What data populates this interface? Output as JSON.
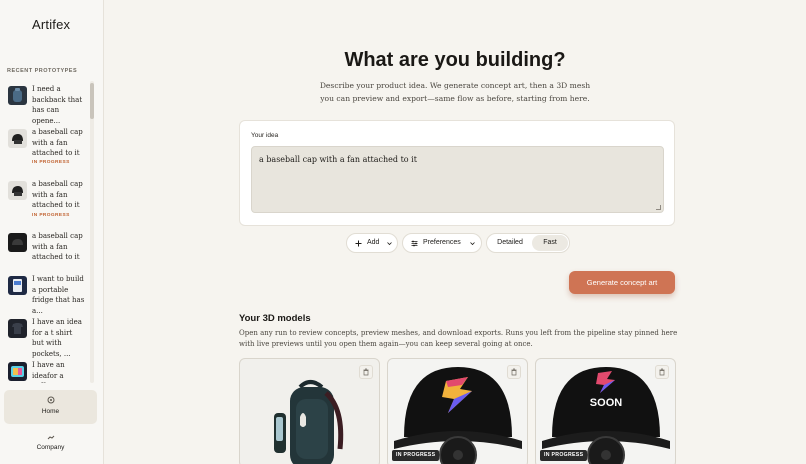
{
  "app": {
    "brand": "Artifex"
  },
  "sidebar": {
    "recent_title": "RECENT PROTOTYPES",
    "items": [
      {
        "text": "I need a backback that has can opene...",
        "status": "",
        "thumb": "backpack"
      },
      {
        "text": "a baseball cap with a fan attached to it",
        "status": "IN PROGRESS",
        "thumb": "cap"
      },
      {
        "text": "a baseball cap with a fan attached to it",
        "status": "IN PROGRESS",
        "thumb": "cap"
      },
      {
        "text": "a baseball cap with a fan attached to it",
        "status": "",
        "thumb": "cap"
      },
      {
        "text": "I want to build a portable fridge that has a...",
        "status": "",
        "thumb": "fridge"
      },
      {
        "text": "I have an idea for a t shirt but with pockets, ...",
        "status": "",
        "thumb": "tshirt"
      },
      {
        "text": "I have an ideafor a coffee",
        "status": "",
        "thumb": "coffee"
      }
    ],
    "nav": {
      "home": "Home",
      "company": "Company"
    }
  },
  "hero": {
    "title": "What are you building?",
    "subtitle": "Describe your product idea. We generate concept art, then a 3D mesh you can preview and export—same flow as before, starting from here."
  },
  "idea": {
    "label": "Your idea",
    "value": "a baseball cap with a fan attached to it"
  },
  "controls": {
    "add": "Add",
    "preferences": "Preferences",
    "detailed": "Detailed",
    "fast": "Fast",
    "selected_mode": "Fast",
    "generate": "Generate concept art"
  },
  "models": {
    "title": "Your 3D models",
    "description": "Open any run to review concepts, preview meshes, and download exports. Runs you left from the pipeline stay pinned here with live previews until you open them again—you can keep several going at once.",
    "cards": [
      {
        "preview": "backpack",
        "status": ""
      },
      {
        "preview": "cap-s",
        "status": "IN PROGRESS"
      },
      {
        "preview": "cap-soon",
        "status": "IN PROGRESS",
        "cap_text": "SOON"
      }
    ]
  },
  "colors": {
    "accent": "#cf7454",
    "status": "#c0612f",
    "background": "#f6f4ef"
  }
}
